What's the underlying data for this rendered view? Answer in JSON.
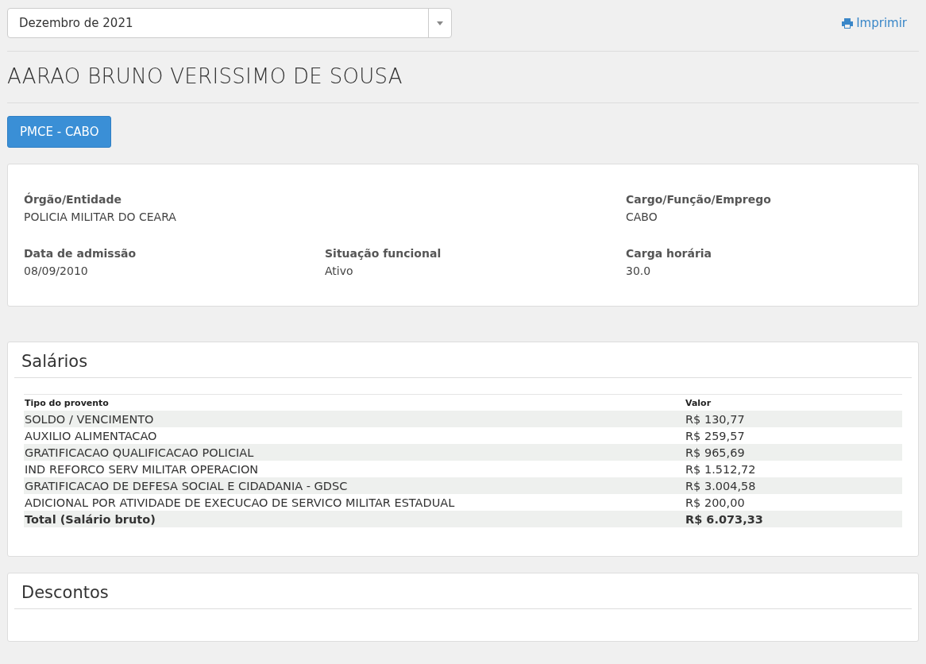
{
  "period_select": {
    "value": "Dezembro de 2021"
  },
  "print_link": "Imprimir",
  "person_name": "AARAO BRUNO VERISSIMO DE SOUSA",
  "role_button": "PMCE - CABO",
  "info": [
    {
      "label": "Órgão/Entidade",
      "value": "POLICIA MILITAR DO CEARA"
    },
    {
      "label": "Cargo/Função/Emprego",
      "value": "CABO"
    },
    {
      "label": "Data de admissão",
      "value": "08/09/2010"
    },
    {
      "label": "Situação funcional",
      "value": "Ativo"
    },
    {
      "label": "Carga horária",
      "value": "30.0"
    }
  ],
  "salaries": {
    "title": "Salários",
    "columns": [
      "Tipo do provento",
      "Valor"
    ],
    "rows": [
      {
        "type": "SOLDO / VENCIMENTO",
        "value": "R$ 130,77"
      },
      {
        "type": "AUXILIO ALIMENTACAO",
        "value": "R$ 259,57"
      },
      {
        "type": "GRATIFICACAO QUALIFICACAO POLICIAL",
        "value": "R$ 965,69"
      },
      {
        "type": "IND REFORCO SERV MILITAR OPERACION",
        "value": "R$ 1.512,72"
      },
      {
        "type": "GRATIFICACAO DE DEFESA SOCIAL E CIDADANIA - GDSC",
        "value": "R$ 3.004,58"
      },
      {
        "type": "ADICIONAL POR ATIVIDADE DE EXECUCAO DE SERVICO MILITAR ESTADUAL",
        "value": "R$ 200,00"
      }
    ],
    "total": {
      "type": "Total (Salário bruto)",
      "value": "R$ 6.073,33"
    }
  },
  "discounts": {
    "title": "Descontos"
  }
}
